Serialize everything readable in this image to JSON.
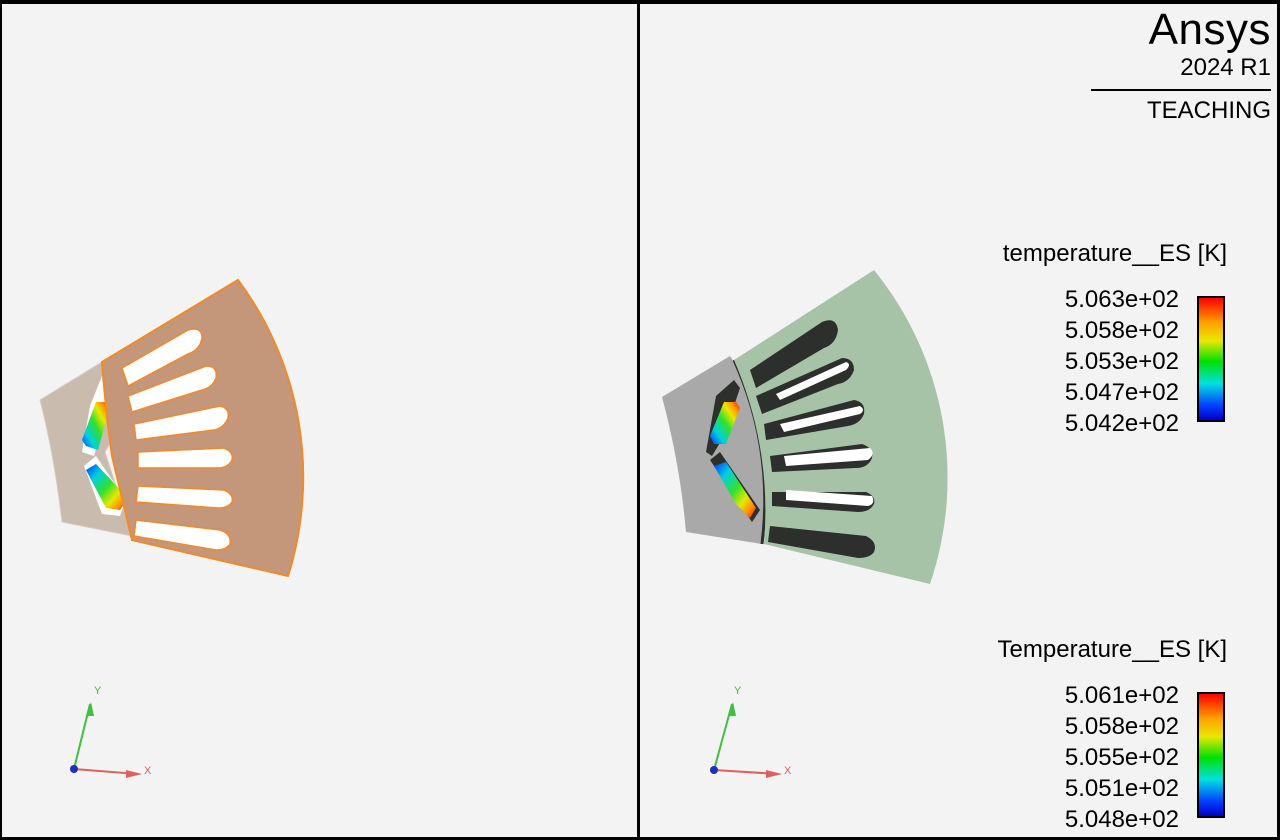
{
  "brand": {
    "name": "Ansys",
    "version": "2024 R1",
    "edition": "TEACHING"
  },
  "colors": {
    "viewport_bg": "#f3f3f3",
    "stator_left": "#c4967a",
    "stator_left_outline": "#f08a2a",
    "rotor_left": "#c9bcae",
    "stator_right": "#a7c3a7",
    "rotor_right": "#a9a9a9",
    "winding_dark": "#2c2f2c"
  },
  "legends": [
    {
      "title": "temperature__ES [K]",
      "ticks": [
        "5.063e+02",
        "5.058e+02",
        "5.053e+02",
        "5.047e+02",
        "5.042e+02"
      ]
    },
    {
      "title": "Temperature__ES [K]",
      "ticks": [
        "5.061e+02",
        "5.058e+02",
        "5.055e+02",
        "5.051e+02",
        "5.048e+02"
      ]
    }
  ],
  "axes": {
    "x_label": "X",
    "y_label": "Y",
    "x_color": "#e06060",
    "y_color": "#40c040",
    "z_color": "#1a30c0"
  },
  "icons": {
    "triad": "xyz-triad-icon",
    "colorbar": "colorbar-icon"
  }
}
